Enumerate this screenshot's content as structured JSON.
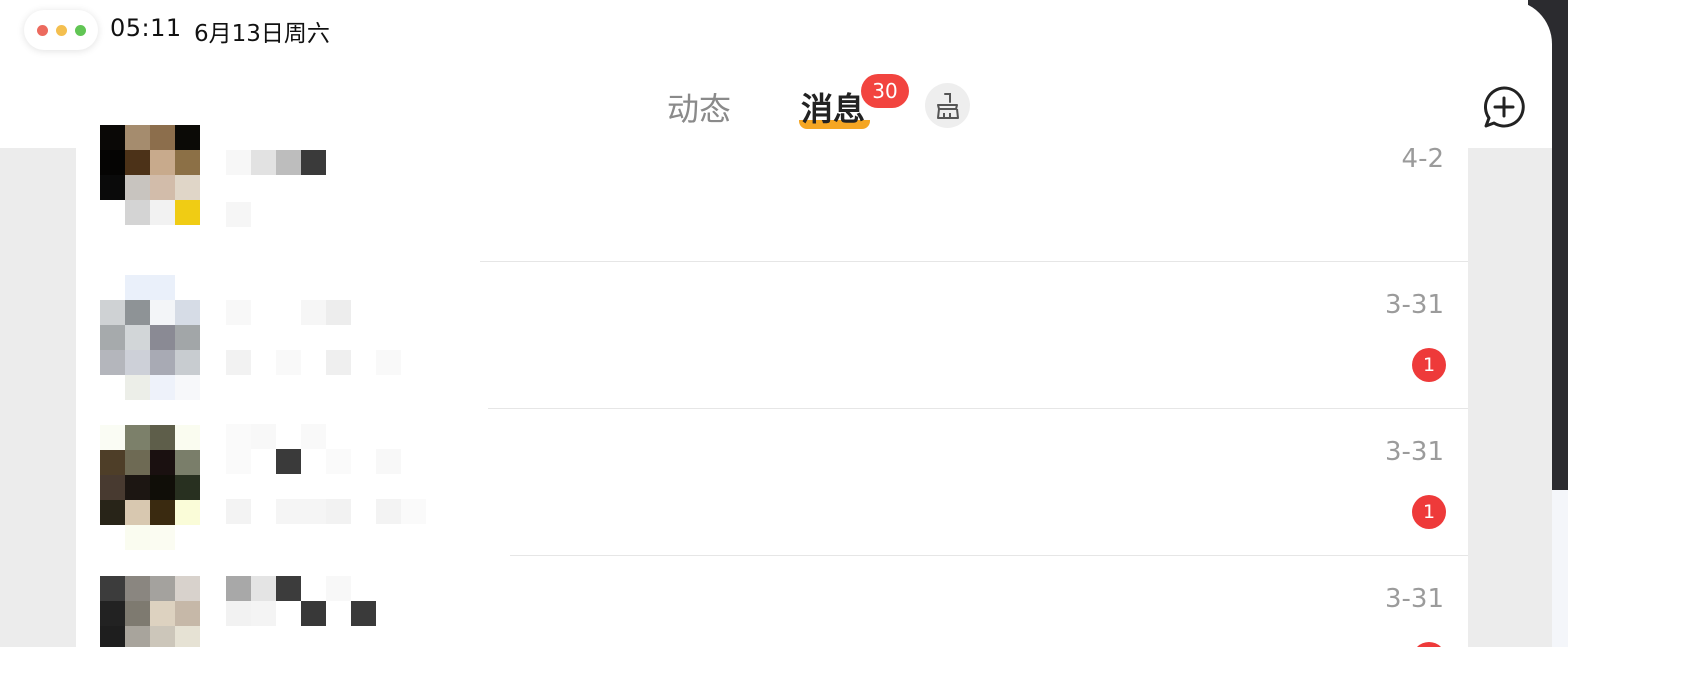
{
  "status_bar": {
    "time": "05:11",
    "date": "6月13日周六",
    "window_dots": [
      "#ec6a5e",
      "#f4bf4f",
      "#61c554"
    ]
  },
  "tabs": {
    "items": [
      {
        "label": "动态",
        "active": false
      },
      {
        "label": "消息",
        "active": true
      }
    ],
    "badge": "30",
    "accent_color": "#f5a623",
    "clean_icon": "broom-icon"
  },
  "header_actions": {
    "new_message_icon": "chat-plus-icon"
  },
  "conversations": [
    {
      "date": "4-2",
      "unread": null
    },
    {
      "date": "3-31",
      "unread": "1"
    },
    {
      "date": "3-31",
      "unread": "1"
    },
    {
      "date": "3-31",
      "unread": ""
    }
  ],
  "colors": {
    "badge_red": "#ee3a3a",
    "muted_text": "#9b9b9b"
  }
}
